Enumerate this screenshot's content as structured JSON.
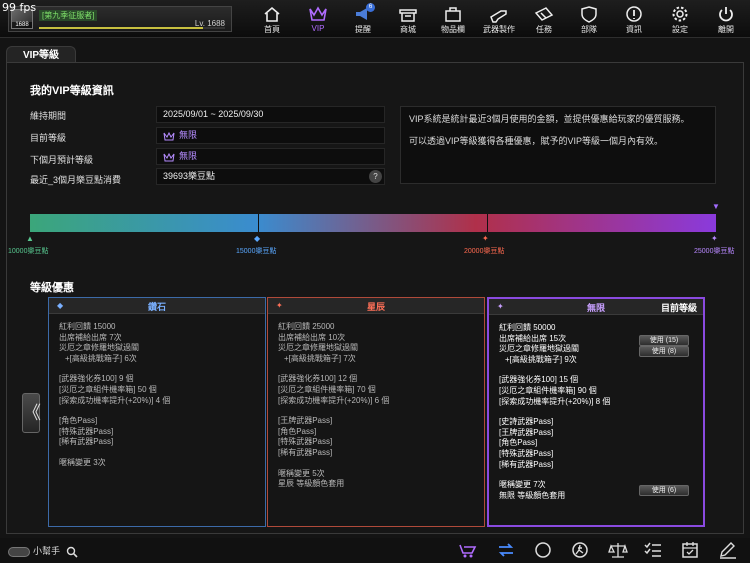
{
  "fps": "99 fps",
  "player": {
    "name": "[第九季征服者]",
    "level": "Lv. 1688",
    "avatar_level": "1688",
    "exp_fraction": 0.88
  },
  "nav": [
    {
      "label": "首頁",
      "icon": "home-icon"
    },
    {
      "label": "VIP",
      "icon": "vip-crown-icon",
      "active": true
    },
    {
      "label": "提醒",
      "icon": "megaphone-icon",
      "badge": "6"
    },
    {
      "label": "商城",
      "icon": "shop-icon"
    },
    {
      "label": "物品欄",
      "icon": "bag-icon"
    },
    {
      "label": "武器製作",
      "icon": "weapon-craft-icon"
    },
    {
      "label": "任務",
      "icon": "ticket-icon"
    },
    {
      "label": "部隊",
      "icon": "shield-icon"
    },
    {
      "label": "資訊",
      "icon": "info-icon"
    },
    {
      "label": "設定",
      "icon": "gear-icon"
    },
    {
      "label": "離開",
      "icon": "power-icon"
    }
  ],
  "tab_title": "VIP等級",
  "info": {
    "heading": "我的VIP等級資訊",
    "period_label": "維持期間",
    "period_value": "2025/09/01 ~ 2025/09/30",
    "current_label": "目前等級",
    "current_value": "無限",
    "next_label": "下個月預計等級",
    "next_value": "無限",
    "spend_label": "最近_3個月樂豆點消費",
    "spend_value": "39693樂豆點",
    "help": "?",
    "desc_1": "VIP系統是統計最近3個月使用的金額，並提供優惠給玩家的優質服務。",
    "desc_2": "可以透過VIP等級獲得各種優惠，賦予的VIP等級一個月內有效。"
  },
  "milestones": [
    "10000樂豆點",
    "15000樂豆點",
    "20000樂豆點",
    "25000樂豆點"
  ],
  "benefits_heading": "等級優惠",
  "colors": {
    "diamond": "#7ab0ff",
    "star": "#ff7058",
    "infinite": "#c8a0ff",
    "accent": "#8a4ae0"
  },
  "cards": [
    {
      "title": "鑽石",
      "lines": [
        "紅利回饋 15000",
        "出席補給出席 7次",
        "災厄之章修羅地獄過關",
        "+[高級挑戰箱子] 6次",
        "",
        "[武器強化券100] 9 個",
        "[災厄之章組件機率箱] 50 個",
        "[探索成功機率提升(+20%)] 4 個",
        "",
        "[角色Pass]",
        "[特殊武器Pass]",
        "[稀有武器Pass]",
        "",
        "暱稱變更 3次"
      ]
    },
    {
      "title": "星辰",
      "lines": [
        "紅利回饋 25000",
        "出席補給出席 10次",
        "災厄之章修羅地獄過關",
        "+[高級挑戰箱子] 7次",
        "",
        "[武器強化券100] 12 個",
        "[災厄之章組件機率箱] 70 個",
        "[探索成功機率提升(+20%)] 6 個",
        "",
        "[王牌武器Pass]",
        "[角色Pass]",
        "[特殊武器Pass]",
        "[稀有武器Pass]",
        "",
        "暱稱變更 5次",
        "星辰 等級顏色套用"
      ]
    },
    {
      "title": "無限",
      "current": "目前等級",
      "lines": [
        "紅利回饋 50000",
        "出席補給出席 15次",
        "災厄之章修羅地獄過關",
        "+[高級挑戰箱子] 9次",
        "",
        "[武器強化券100] 15 個",
        "[災厄之章組件機率箱] 90 個",
        "[探索成功機率提升(+20%)] 8 個",
        "",
        "[史詩武器Pass]",
        "[王牌武器Pass]",
        "[角色Pass]",
        "[特殊武器Pass]",
        "[稀有武器Pass]",
        "",
        "暱稱變更 7次",
        "無限 等級顏色套用"
      ],
      "buttons": [
        "使用 (15)",
        "使用 (8)",
        "使用 (6)"
      ]
    }
  ],
  "prev_arrow": "《",
  "helper_label": "小幫手"
}
